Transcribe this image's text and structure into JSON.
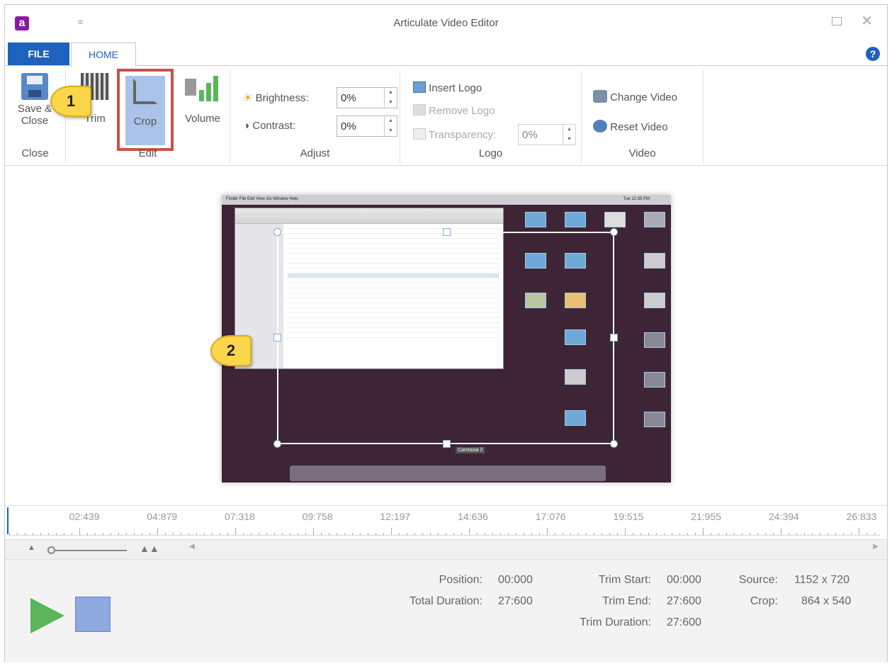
{
  "window": {
    "title": "Articulate Video Editor",
    "app_icon_glyph": "a",
    "qat_glyph": "="
  },
  "tabs": {
    "file": "FILE",
    "home": "HOME",
    "help": "?"
  },
  "ribbon": {
    "close_group": {
      "label": "Close",
      "save_close_line1": "Save &",
      "save_close_line2": "Close"
    },
    "edit_group": {
      "label": "Edit",
      "trim": "Trim",
      "crop": "Crop",
      "volume": "Volume"
    },
    "adjust_group": {
      "label": "Adjust",
      "brightness_label": "Brightness:",
      "brightness_value": "0%",
      "contrast_label": "Contrast:",
      "contrast_value": "0%"
    },
    "logo_group": {
      "label": "Logo",
      "insert_logo": "Insert Logo",
      "remove_logo": "Remove Logo",
      "transparency_label": "Transparency:",
      "transparency_value": "0%"
    },
    "video_group": {
      "label": "Video",
      "change_video": "Change Video",
      "reset_video": "Reset Video"
    }
  },
  "callouts": {
    "one": "1",
    "two": "2"
  },
  "preview": {
    "crop_caption": "Camtasia 2",
    "mac_menu": "Finder  File  Edit  View  Go  Window  Help",
    "clock": "Tue 12:35 PM"
  },
  "timeline": {
    "ticks": [
      "02:439",
      "04:879",
      "07:318",
      "09:758",
      "12:197",
      "14:636",
      "17:076",
      "19:515",
      "21:955",
      "24:394",
      "26:833"
    ]
  },
  "info": {
    "position_label": "Position:",
    "position_value": "00:000",
    "total_duration_label": "Total Duration:",
    "total_duration_value": "27:600",
    "trim_start_label": "Trim Start:",
    "trim_start_value": "00:000",
    "trim_end_label": "Trim End:",
    "trim_end_value": "27:600",
    "trim_duration_label": "Trim Duration:",
    "trim_duration_value": "27:600",
    "source_label": "Source:",
    "source_value": "1152 x 720",
    "crop_label": "Crop:",
    "crop_value": "864 x 540"
  },
  "colors": {
    "accent": "#1e62bd",
    "crop_highlight": "#c9524a",
    "play": "#5cb55a",
    "stop": "#8ea8e0",
    "callout": "#fbd64a"
  }
}
